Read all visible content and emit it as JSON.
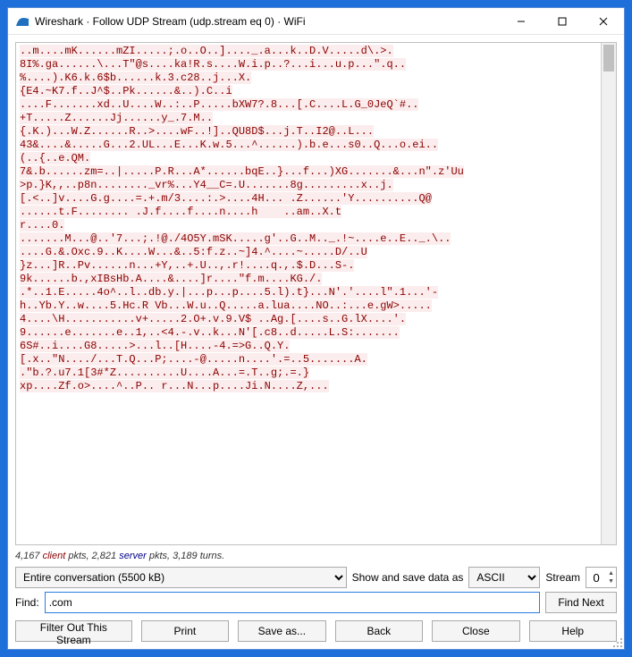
{
  "window": {
    "title": "Wireshark · Follow UDP Stream (udp.stream eq 0) · WiFi"
  },
  "stream_lines": [
    "..m....mK......mZI.....;.o..O..]...._.a...k..D.V.....d\\.>.",
    "8I%.ga......\\...T\"@s....ka!R.s....W.i.p..?...i...u.p...\".q..",
    "%....).K6.k.6$b......k.3.c28..j...X.",
    "{E4.~K7.f..J^$..Pk......&..).C..i",
    "....F.......xd..U....W..:..P.....bXW7?.8...[.C....L.G_0JeQ`#..",
    "+T.....Z......Jj......y_.7.M..",
    "{.K.)...W.Z......R..>....wF..!]..QU8D$...j.T..I2@..L...",
    "43&....&.....G...2.UL...E...K.w.5...^......).b.e...s0..Q...o.ei..",
    "(..{..e.QM.",
    "7&.b......zm=..|.....P.R...A*......bqE..}...f...)XG.......&...n\".z'Uu",
    ">p.}K,,..p8n........_vr%...Y4__C=.U.......8g.........x..j.",
    "[.<..]v....G.g....=.+.m/3....:.>....4H... .Z......'Y..........Q@",
    "......t.F........ .J.f....f....n....h    ..am..X.t",
    "r....0.",
    ".......M...@..'7...;.!@./4O5Y.mSK.....g'..G..M.._.!~....e..E.._.\\..",
    "....G.&.Oxc.9..K....W...&..5:f.z..~]4.^....~.....D/..U",
    "}z...]R..Pv......n...+Y,..+.U..,.r!....q.,.$.D...S-.",
    "9k......b.,xIBsHb.A....&....]r....\"f.m....KG./.",
    ".*..1.E.....4o^..l..db.y.|...p...p....5.l).t}...N'.'....l\".1...'-",
    "h..Yb.Y..w....5.Hc.R Vb...W.u..Q.....a.lua....NO..:...e.gW>.....",
    "4....\\H...........v+.....2.O+.v.9.V$ ..Ag.[....s..G.lX....'.",
    "9......e.......e..1,..<4.-.v..k...N'[.c8..d.....L.S:.......",
    "6S#..i....G8.....>...l..[H....-4.=>G..Q.Y.",
    "[.x..\"N..../...T.Q...P;....-@.....n....'.=..5.......A.",
    ".\"b.?.u7.1[3#*Z..........U....A...=.T..g;.=.}",
    "xp....Zf.o>....^..P.. r...N...p....Ji.N....Z,..."
  ],
  "stats": {
    "client_pkts": "4,167",
    "client_label": "client",
    "mid1": " pkts, ",
    "server_pkts": "2,821",
    "server_label": "server",
    "mid2": " pkts, ",
    "turns": "3,189 turns."
  },
  "controls": {
    "conversation": "Entire conversation (5500 kB)",
    "show_label": "Show and save data as",
    "encoding": "ASCII",
    "stream_label": "Stream",
    "stream_num": "0"
  },
  "find": {
    "label": "Find:",
    "value": ".com",
    "button": "Find Next"
  },
  "buttons": {
    "filter_out": "Filter Out This Stream",
    "print": "Print",
    "save_as": "Save as...",
    "back": "Back",
    "close": "Close",
    "help": "Help"
  }
}
